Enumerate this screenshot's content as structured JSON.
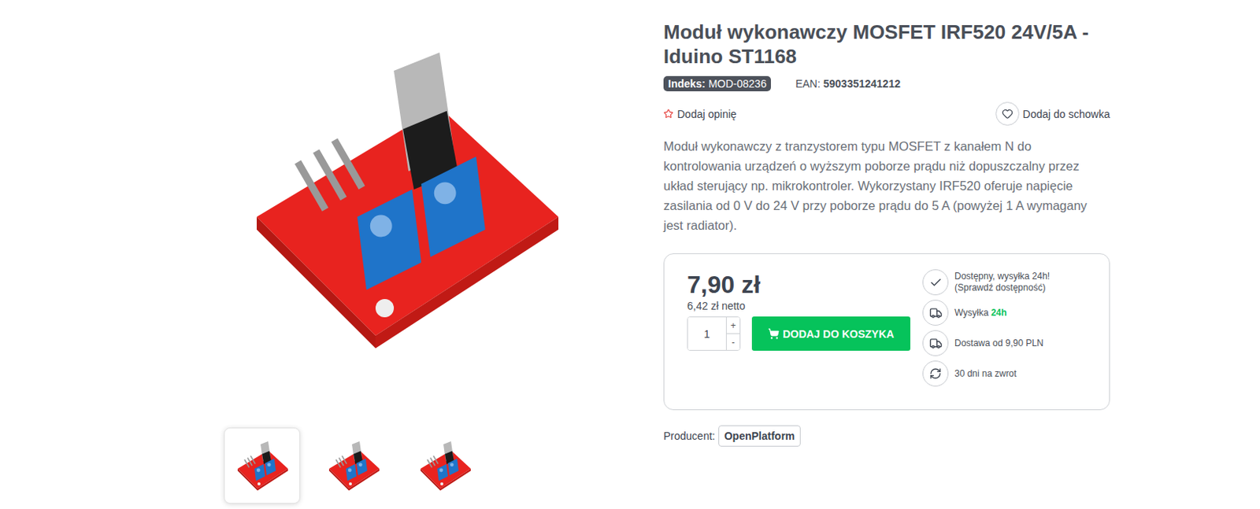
{
  "product": {
    "title": "Moduł wykonawczy MOSFET IRF520 24V/5A - Iduino ST1168",
    "index_label": "Indeks:",
    "index": "MOD-08236",
    "ean_label": "EAN:",
    "ean": "5903351241212",
    "add_review": "Dodaj opinię",
    "add_to_wishlist": "Dodaj do schowka",
    "description": "Moduł wykonawczy z tranzystorem typu MOSFET z kanałem N do kontrolowania urządzeń o wyższym poborze prądu niż dopuszczalny przez układ sterujący np. mikrokontroler. Wykorzystany IRF520 oferuje napięcie zasilania od 0 V do 24 V przy poborze prądu do 5 A (powyżej 1 A wymagany jest radiator)."
  },
  "purchase": {
    "price": "7,90 zł",
    "net": "6,42 zł netto",
    "quantity": "1",
    "plus": "+",
    "minus": "-",
    "add_to_cart": "DODAJ DO KOSZYKA"
  },
  "info": [
    {
      "kind": "available",
      "text": "Dostępny, wysyłka 24h!",
      "sub": "(Sprawdź dostępność)",
      "highlight": ""
    },
    {
      "kind": "shipping",
      "text": "Wysyłka ",
      "sub": "",
      "highlight": "24h"
    },
    {
      "kind": "delivery",
      "text": "Dostawa od 9,90 PLN",
      "sub": "",
      "highlight": ""
    },
    {
      "kind": "returns",
      "text": "30 dni na zwrot",
      "sub": "",
      "highlight": ""
    }
  ],
  "producer": {
    "label": "Producent:",
    "name": "OpenPlatform"
  },
  "thumbnails": [
    {
      "selected": true
    },
    {
      "selected": false
    },
    {
      "selected": false
    }
  ]
}
